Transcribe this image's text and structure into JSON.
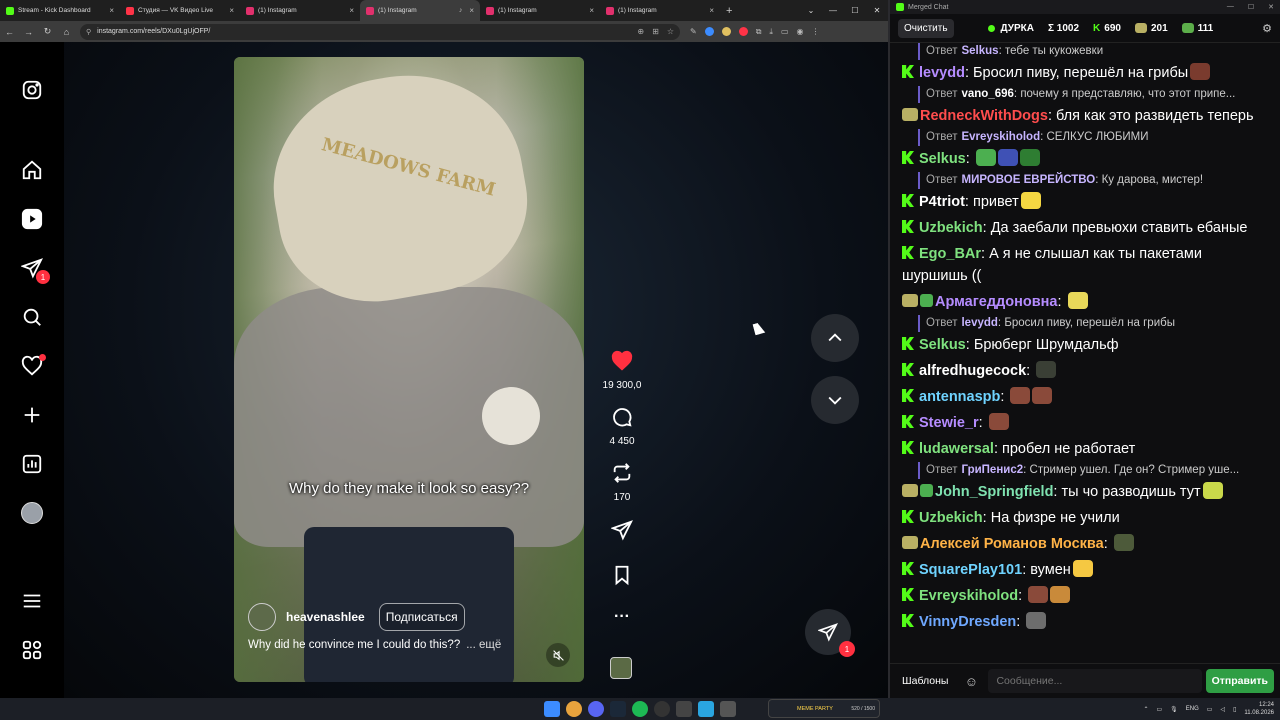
{
  "browser": {
    "tabs": [
      {
        "title": "Stream - Kick Dashboard",
        "color": "#53fc18",
        "active": false
      },
      {
        "title": "Студия — VK Видео Live",
        "color": "#ff3347",
        "active": false
      },
      {
        "title": "(1) Instagram",
        "color": "#e1306c",
        "active": false
      },
      {
        "title": "(1) Instagram",
        "color": "#e1306c",
        "active": true
      },
      {
        "title": "(1) Instagram",
        "color": "#e1306c",
        "active": false
      },
      {
        "title": "(1) Instagram",
        "color": "#e1306c",
        "active": false
      }
    ],
    "url": "instagram.com/reels/DXu0LgUjOFP/"
  },
  "instagram": {
    "subtitle": "Why do they make it look so easy??",
    "author": "heavenashlee",
    "follow_label": "Подписаться",
    "caption": "Why did he convince me I could do this??",
    "caption_more": "... ещё",
    "likes": "19 300,0",
    "comments": "4 450",
    "reposts": "170",
    "dm_badge": "1",
    "cap_text": "MEADOWS FARM"
  },
  "chat": {
    "window_title": "Merged Chat",
    "clear_label": "Очистить",
    "stream_name": "ДУРКА",
    "total": "Σ 1002",
    "kick_count": "690",
    "vk_count": "201",
    "other_count": "111",
    "messages": [
      {
        "type": "reply",
        "label": "Ответ",
        "user": "Selkus",
        "ucolor": "#c7b5ff",
        "text": "тебе ты кукожевки"
      },
      {
        "type": "msg",
        "badge": "kick",
        "user": "levydd",
        "ucolor": "#b58cff",
        "text": "Бросил пиву, перешёл на грибы",
        "emotes": [
          "#7a3b2e"
        ]
      },
      {
        "type": "reply",
        "label": "Ответ",
        "user": "vano_696",
        "ucolor": "#ffffff",
        "text": "почему я представляю, что этот припе..."
      },
      {
        "type": "msg",
        "badge": "emote",
        "user": "RedneckWithDogs",
        "ucolor": "#ff4d4d",
        "text": "бля как это развидеть теперь",
        "emotes": []
      },
      {
        "type": "reply",
        "label": "Ответ",
        "user": "Evreyskiholod",
        "ucolor": "#c7b5ff",
        "text": "СЕЛКУС ЛЮБИМИ"
      },
      {
        "type": "msg",
        "badge": "kick",
        "user": "Selkus",
        "ucolor": "#7fe27f",
        "text": "",
        "emotes": [
          "#4caf50",
          "#3f51b5",
          "#2e7d32"
        ]
      },
      {
        "type": "reply",
        "label": "Ответ",
        "user": "МИРОВОЕ ЕВРЕЙСТВО",
        "ucolor": "#c7b5ff",
        "text": "Ку дарова, мистер!"
      },
      {
        "type": "msg",
        "badge": "kick",
        "user": "P4triot",
        "ucolor": "#ffffff",
        "text": "привет",
        "emotes": [
          "#f5d742"
        ]
      },
      {
        "type": "msg",
        "badge": "kick",
        "user": "Uzbekich",
        "ucolor": "#7fe27f",
        "text": "Да заебали превьюхи ставить ебаные",
        "emotes": []
      },
      {
        "type": "msg",
        "badge": "kick",
        "user": "Ego_BAr",
        "ucolor": "#7fe27f",
        "text": "А я не слышал как ты пакетами шуршишь ((",
        "emotes": []
      },
      {
        "type": "msg",
        "badge": "emote2",
        "user": "Армагеддоновна",
        "ucolor": "#b58cff",
        "text": "",
        "emotes": [
          "#e8d85a"
        ]
      },
      {
        "type": "reply",
        "label": "Ответ",
        "user": "levydd",
        "ucolor": "#c7b5ff",
        "text": "Бросил пиву, перешёл на грибы"
      },
      {
        "type": "msg",
        "badge": "kick",
        "user": "Selkus",
        "ucolor": "#7fe27f",
        "text": "Брюберг Шрумдальф",
        "emotes": []
      },
      {
        "type": "msg",
        "badge": "kick",
        "user": "alfredhugecock",
        "ucolor": "#ffffff",
        "text": "",
        "emotes": [
          "#3a3f35"
        ]
      },
      {
        "type": "msg",
        "badge": "kick",
        "user": "antennaspb",
        "ucolor": "#6fd3ff",
        "text": "",
        "emotes": [
          "#8a4a3a",
          "#8a4a3a"
        ]
      },
      {
        "type": "msg",
        "badge": "kick",
        "user": "Stewie_r",
        "ucolor": "#b58cff",
        "text": "",
        "emotes": [
          "#8a4a3a"
        ]
      },
      {
        "type": "msg",
        "badge": "kick",
        "user": "ludawersal",
        "ucolor": "#7fe27f",
        "text": "пробел не работает",
        "emotes": []
      },
      {
        "type": "reply",
        "label": "Ответ",
        "user": "ГриПенис2",
        "ucolor": "#c7b5ff",
        "text": "Стример ушел. Где он? Стример уше..."
      },
      {
        "type": "msg",
        "badge": "emote2",
        "user": "John_Springfield",
        "ucolor": "#7fe2b0",
        "text": "ты чо разводишь тут",
        "emotes": [
          "#c9d84a"
        ]
      },
      {
        "type": "msg",
        "badge": "kick",
        "user": "Uzbekich",
        "ucolor": "#7fe27f",
        "text": "На физре не учили",
        "emotes": []
      },
      {
        "type": "msg",
        "badge": "emote",
        "user": "Алексей Романов Москва",
        "ucolor": "#ffb347",
        "text": "",
        "emotes": [
          "#4d5a3a"
        ]
      },
      {
        "type": "msg",
        "badge": "kick",
        "user": "SquarePlay101",
        "ucolor": "#6fd3ff",
        "text": "вумен",
        "emotes": [
          "#f5c842"
        ]
      },
      {
        "type": "msg",
        "badge": "kick",
        "user": "Evreyskiholod",
        "ucolor": "#7fe27f",
        "text": "",
        "emotes": [
          "#8a4a3a",
          "#c98a3a"
        ]
      },
      {
        "type": "msg",
        "badge": "kick",
        "user": "VinnyDresden",
        "ucolor": "#6fa8ff",
        "text": "",
        "emotes": [
          "#6d6d6d"
        ]
      }
    ],
    "templates_label": "Шаблоны",
    "input_placeholder": "Сообщение...",
    "send_label": "Отправить"
  },
  "taskbar": {
    "meme_party_label": "MEME PARTY",
    "meme_party_count": "520 / 1500",
    "lang": "ENG",
    "time": "12:24",
    "date": "11.08.2026"
  }
}
